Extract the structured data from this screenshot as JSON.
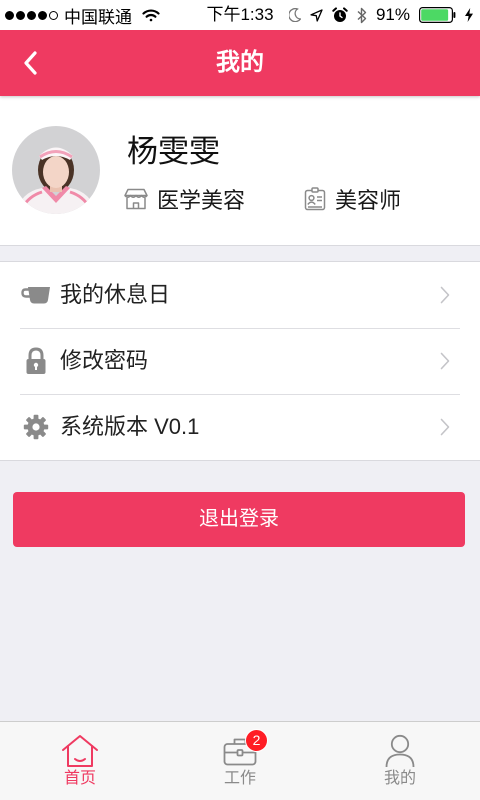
{
  "status_bar": {
    "signal_strength": 4,
    "signal_max": 5,
    "carrier": "中国联通",
    "time": "下午1:33",
    "battery_percent": "91%",
    "battery_level": 0.91,
    "icons": [
      "wifi-icon",
      "moon-icon",
      "location-arrow-icon",
      "alarm-icon",
      "bluetooth-icon",
      "battery-icon",
      "charging-bolt-icon"
    ]
  },
  "nav": {
    "title": "我的",
    "back_icon": "chevron-left-icon"
  },
  "profile": {
    "name": "杨雯雯",
    "department": "医学美容",
    "department_icon": "store-icon",
    "role": "美容师",
    "role_icon": "id-card-icon"
  },
  "menu": [
    {
      "label": "我的休息日",
      "icon": "cup-icon"
    },
    {
      "label": "修改密码",
      "icon": "lock-icon"
    },
    {
      "label": "系统版本 V0.1",
      "icon": "gear-icon"
    }
  ],
  "logout": {
    "label": "退出登录"
  },
  "tabbar": {
    "items": [
      {
        "label": "首页",
        "icon": "home-icon",
        "active": true
      },
      {
        "label": "工作",
        "icon": "briefcase-icon",
        "active": false,
        "badge": "2"
      },
      {
        "label": "我的",
        "icon": "person-icon",
        "active": false
      }
    ]
  },
  "colors": {
    "accent": "#EF3A61",
    "background": "#EFEFF4",
    "badge": "#FF1D25",
    "battery": "#4CD964"
  }
}
